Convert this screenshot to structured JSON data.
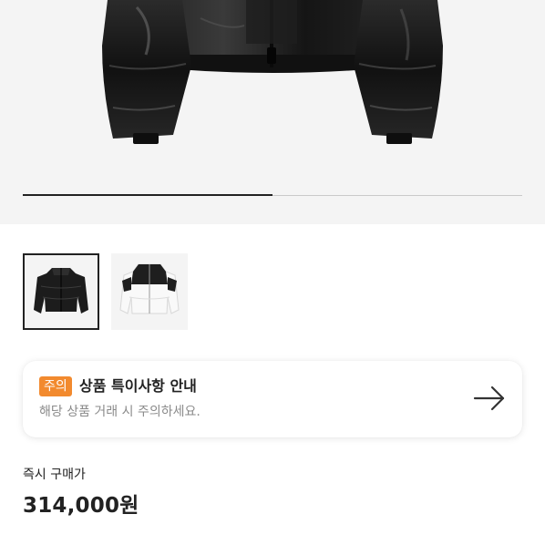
{
  "product": {
    "hero_image_icon": "black-cropped-down-jacket-image",
    "gallery_progress": 0.5,
    "thumbnails": [
      {
        "icon": "black-jacket-thumbnail",
        "selected": true
      },
      {
        "icon": "white-jacket-thumbnail",
        "selected": false
      }
    ]
  },
  "notice": {
    "badge": "주의",
    "badge_color": "#f28a2e",
    "title": "상품 특이사항 안내",
    "description": "해당 상품 거래 시 주의하세요.",
    "arrow_icon": "arrow-right-icon"
  },
  "price": {
    "label": "즉시 구매가",
    "value": "314,000원"
  },
  "colors": {
    "background": "#ffffff",
    "image_background": "#f4f4f4",
    "text_primary": "#222222",
    "text_secondary": "#8a8a8a",
    "accent": "#f28a2e"
  }
}
